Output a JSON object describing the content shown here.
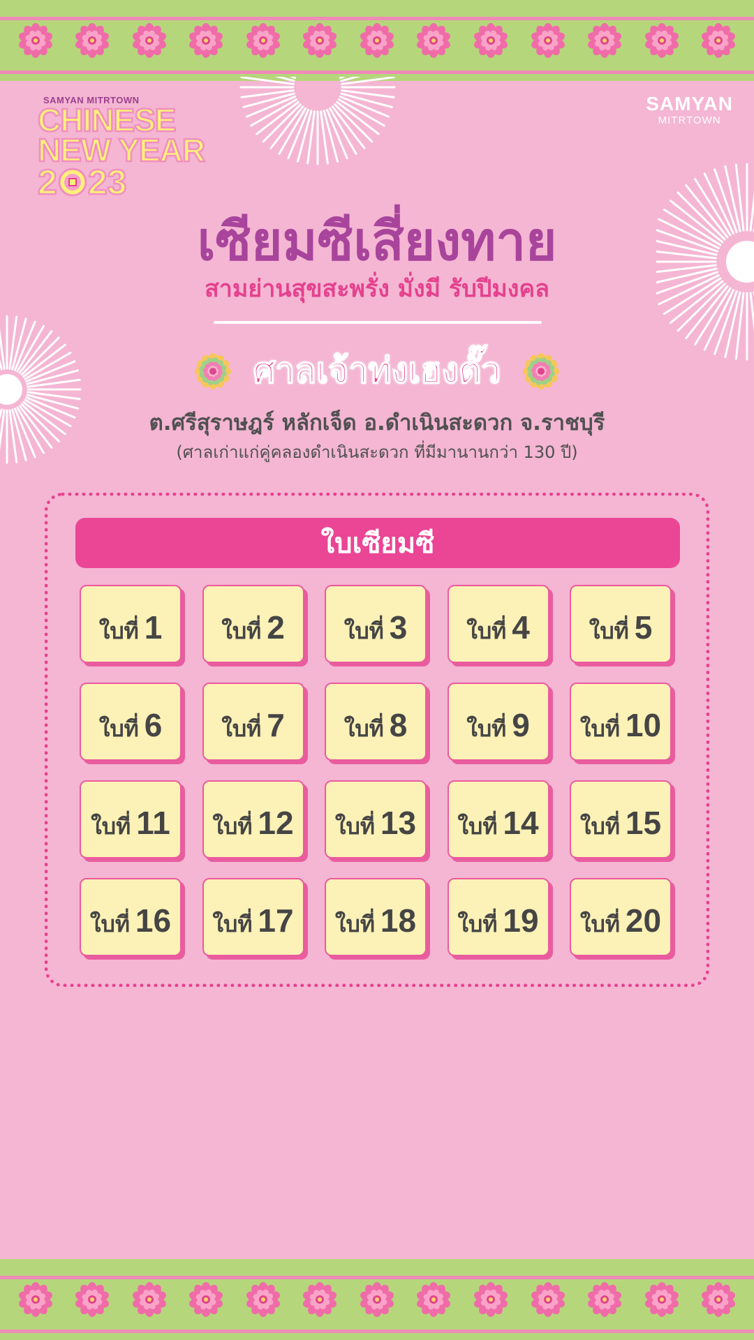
{
  "logo_cny": {
    "brand": "SAMYAN MITRTOWN",
    "line1": "CHINESE",
    "line2": "NEW YEAR",
    "year_prefix": "2",
    "year_suffix": "23"
  },
  "logo_samyan": {
    "main": "SAMYAN",
    "sub": "MITRTOWN"
  },
  "header": {
    "title": "เซียมซีเสี่ยงทาย",
    "subtitle": "สามย่านสุขสะพรั่ง มั่งมี รับปีมงคล"
  },
  "shrine": {
    "name": "ศาลเจ้าท่งเฮงตั๊ว",
    "address": "ต.ศรีสุราษฎร์ หลักเจ็ด  อ.ดำเนินสะดวก จ.ราชบุรี",
    "note": "(ศาลเก่าแก่คู่คลองดำเนินสะดวก ที่มีมานานกว่า 130 ปี)"
  },
  "panel": {
    "header": "ใบเซียมซี",
    "card_prefix": "ใบที่",
    "cards": [
      "1",
      "2",
      "3",
      "4",
      "5",
      "6",
      "7",
      "8",
      "9",
      "10",
      "11",
      "12",
      "13",
      "14",
      "15",
      "16",
      "17",
      "18",
      "19",
      "20"
    ]
  },
  "colors": {
    "background": "#f4b6d3",
    "title_purple": "#a8449b",
    "accent_pink": "#eb4595",
    "card_yellow": "#fcf1b6",
    "border_green": "#b6d67c"
  },
  "icons": {
    "border_flower": "pink-flower-icon",
    "shrine_flower": "lotus-flower-icon",
    "coin": "chinese-coin-icon",
    "firework": "firework-burst-icon"
  }
}
